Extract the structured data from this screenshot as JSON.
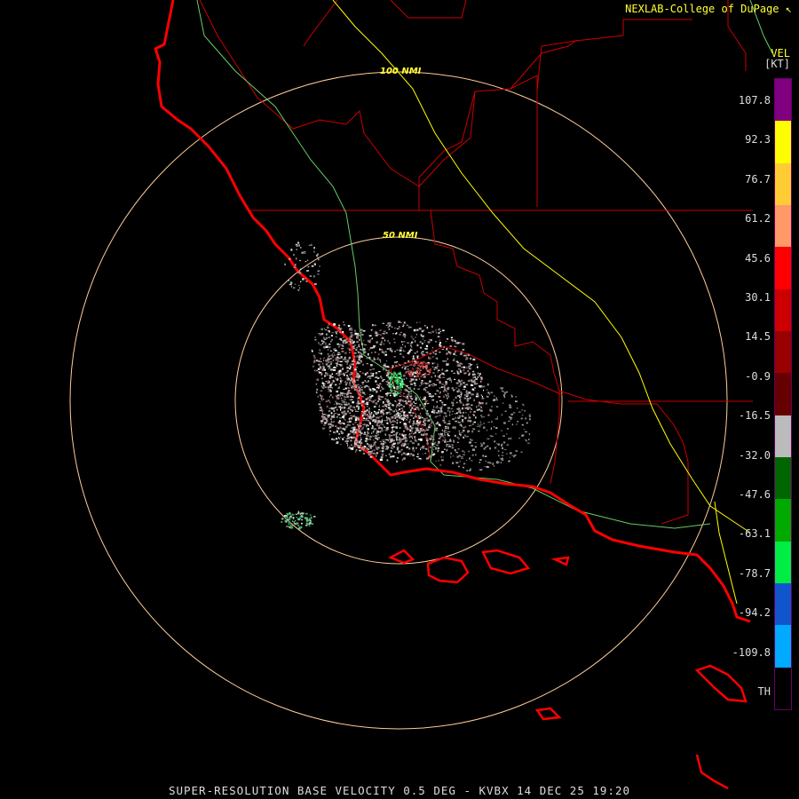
{
  "credit": "NEXLAB-College of DuPage",
  "credit_mark": "↖",
  "footer": "SUPER-RESOLUTION BASE VELOCITY 0.5 DEG - KVBX 14 DEC 25 19:20",
  "legend": {
    "title": "VEL",
    "unit": "[KT]",
    "labels": [
      "107.8",
      "92.3",
      "76.7",
      "61.2",
      "45.6",
      "30.1",
      "14.5",
      "-0.9",
      "-16.5",
      "-32.0",
      "-47.6",
      "-63.1",
      "-78.7",
      "-94.2",
      "-109.8",
      "TH"
    ],
    "segments": [
      {
        "color": "#800080"
      },
      {
        "color": "#ffff00"
      },
      {
        "color": "#ffcc33"
      },
      {
        "color": "#ff9966"
      },
      {
        "color": "#ff0000"
      },
      {
        "color": "#cc0000"
      },
      {
        "color": "#990000"
      },
      {
        "color": "#660000"
      },
      {
        "color": "#bbbbbb"
      },
      {
        "color": "#006600"
      },
      {
        "color": "#00aa00"
      },
      {
        "color": "#00ee44"
      },
      {
        "color": "#1155cc"
      },
      {
        "color": "#00aaff"
      },
      {
        "color": "#000000"
      }
    ]
  },
  "rings": [
    {
      "label": "100 NMI"
    },
    {
      "label": "50 NMI"
    }
  ],
  "colors": {
    "coast": "#ff0000",
    "county": "#cc0000",
    "highway_green": "#66cc66",
    "highway_yellow": "#ffff00",
    "ring": "#ffcc99"
  }
}
